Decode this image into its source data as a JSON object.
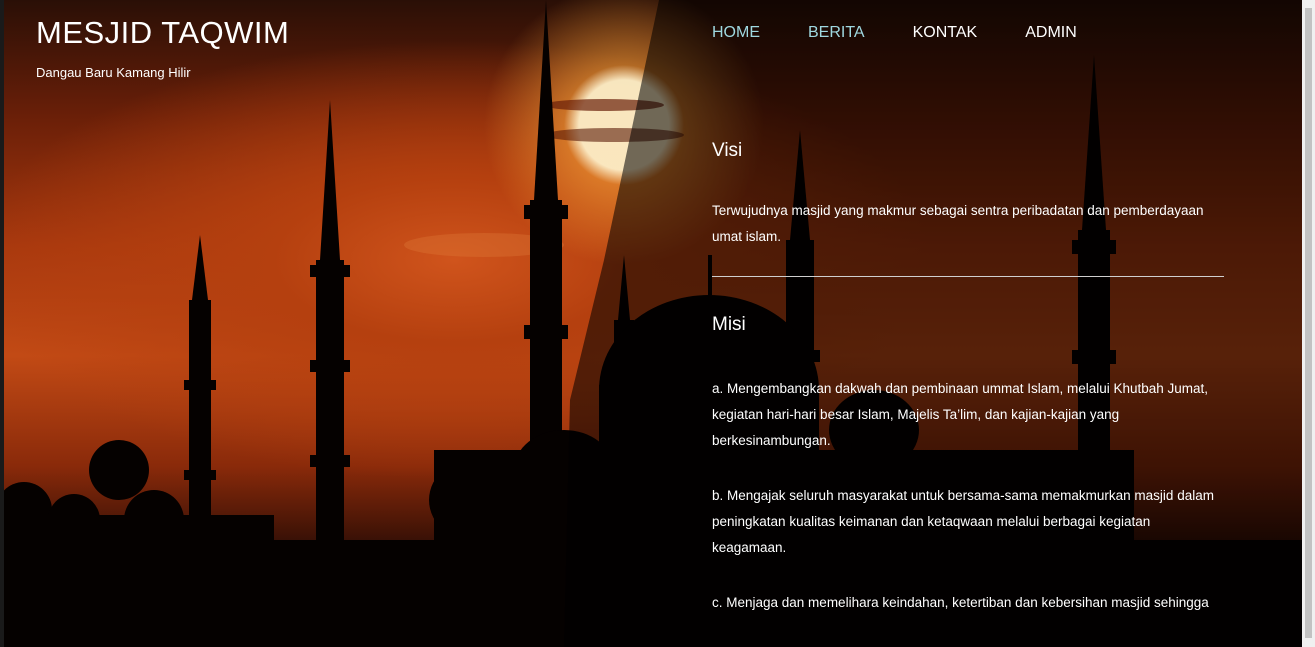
{
  "brand": {
    "title": "MESJID TAQWIM",
    "subtitle": "Dangau Baru Kamang Hilir"
  },
  "nav": {
    "items": [
      {
        "label": "HOME",
        "active": true
      },
      {
        "label": "BERITA",
        "active": true
      },
      {
        "label": "KONTAK",
        "active": false
      },
      {
        "label": "ADMIN",
        "active": false
      }
    ]
  },
  "visi": {
    "title": "Visi",
    "text": "Terwujudnya masjid yang makmur sebagai sentra peribadatan dan pemberdayaan umat islam."
  },
  "misi": {
    "title": "Misi",
    "items": [
      "a. Mengembangkan dakwah dan pembinaan ummat Islam, melalui Khutbah Jumat, kegiatan hari-hari besar Islam, Majelis Ta’lim, dan kajian-kajian yang berkesinambungan.",
      "b. Mengajak seluruh masyarakat untuk bersama-sama memakmurkan masjid dalam peningkatan kualitas keimanan dan ketaqwaan melalui berbagai kegiatan keagamaan.",
      "c. Menjaga dan memelihara keindahan, ketertiban dan kebersihan masjid sehingga"
    ]
  },
  "colors": {
    "nav_active": "#9fd8e0",
    "text": "#ffffff"
  }
}
